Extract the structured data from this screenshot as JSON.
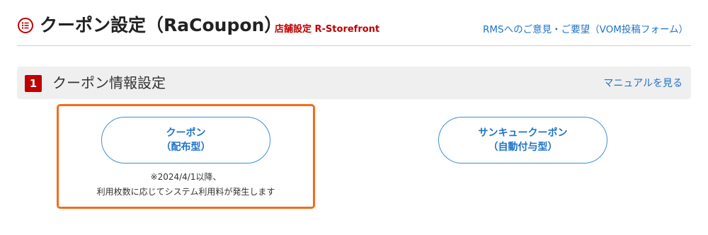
{
  "header": {
    "title": "クーポン設定（RaCoupon）",
    "store_label": "店舗設定 R-Storefront",
    "feedback_link": "RMSへのご意見・ご要望（VOM投稿フォーム）",
    "title_icon": "list-circle-icon",
    "accent_color": "#bf0000"
  },
  "section": {
    "step_number": "1",
    "title": "クーポン情報設定",
    "manual_link": "マニュアルを見る"
  },
  "buttons": {
    "distributed": {
      "line1": "クーポン",
      "line2": "（配布型）"
    },
    "thankyou": {
      "line1": "サンキュークーポン",
      "line2": "（自動付与型）"
    }
  },
  "note": {
    "line1": "※2024/4/1以降、",
    "line2": "利用枚数に応じてシステム利用料が発生します"
  },
  "colors": {
    "link": "#1f73c7",
    "highlight_border": "#f26d1c",
    "section_bg": "#efefef"
  }
}
